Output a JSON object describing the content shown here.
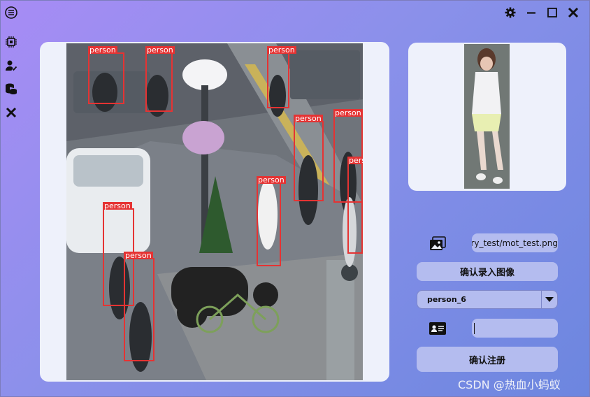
{
  "icons": {
    "menu": "menu-circle-icon",
    "detect": "detect-chip-icon",
    "user": "user-check-icon",
    "database": "database-icon",
    "close_side": "close-icon",
    "settings": "gear-icon",
    "minimize": "minimize-icon",
    "maximize": "maximize-icon",
    "close": "close-icon",
    "image": "image-icon",
    "id_card": "id-card-icon",
    "dropdown": "chevron-down-icon"
  },
  "colors": {
    "bbox": "#e53333",
    "button_bg": "#b4bcef",
    "panel_bg": "#eef1fb"
  },
  "detections": {
    "label": "person",
    "count": 9
  },
  "form": {
    "image_path": "ery_test/mot_test.png",
    "confirm_image_label": "确认录入图像",
    "person_select": "person_6",
    "name_value": "",
    "confirm_register_label": "确认注册"
  },
  "watermark": "CSDN @热血小蚂蚁"
}
